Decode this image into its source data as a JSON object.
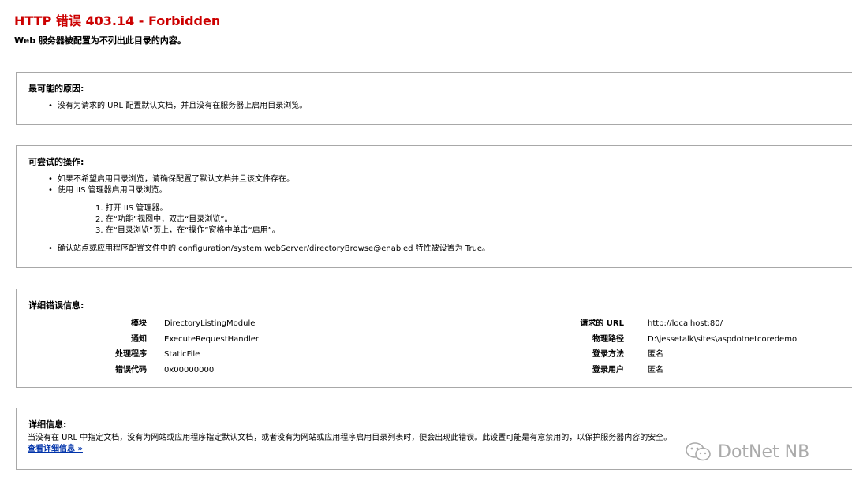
{
  "page": {
    "title": "HTTP 错误 403.14 - Forbidden",
    "subtitle": "Web 服务器被配置为不列出此目录的内容。"
  },
  "causes": {
    "heading": "最可能的原因:",
    "items": [
      "没有为请求的 URL 配置默认文档，并且没有在服务器上启用目录浏览。"
    ]
  },
  "actions": {
    "heading": "可尝试的操作:",
    "items": [
      "如果不希望启用目录浏览，请确保配置了默认文档并且该文件存在。",
      "使用 IIS 管理器启用目录浏览。"
    ],
    "steps": [
      "1. 打开 IIS 管理器。",
      "2. 在“功能”视图中，双击“目录浏览”。",
      "3. 在“目录浏览”页上，在“操作”窗格中单击“启用”。"
    ],
    "final_item": "确认站点或应用程序配置文件中的 configuration/system.webServer/directoryBrowse@enabled 特性被设置为 True。"
  },
  "error_details": {
    "heading": "详细错误信息:",
    "left": [
      {
        "key": "模块",
        "value": "DirectoryListingModule"
      },
      {
        "key": "通知",
        "value": "ExecuteRequestHandler"
      },
      {
        "key": "处理程序",
        "value": "StaticFile"
      },
      {
        "key": "错误代码",
        "value": "0x00000000"
      }
    ],
    "right": [
      {
        "key": "请求的 URL",
        "value": "http://localhost:80/"
      },
      {
        "key": "物理路径",
        "value": "D:\\jessetalk\\sites\\aspdotnetcoredemo"
      },
      {
        "key": "登录方法",
        "value": "匿名"
      },
      {
        "key": "登录用户",
        "value": "匿名"
      }
    ]
  },
  "more_info": {
    "heading": "详细信息:",
    "text": "当没有在 URL 中指定文档，没有为网站或应用程序指定默认文档，或者没有为网站或应用程序启用目录列表时，便会出现此错误。此设置可能是有意禁用的，以保护服务器内容的安全。",
    "link_label": "查看详细信息 »"
  },
  "watermark": {
    "text": "DotNet NB",
    "icon": "wechat-icon"
  }
}
